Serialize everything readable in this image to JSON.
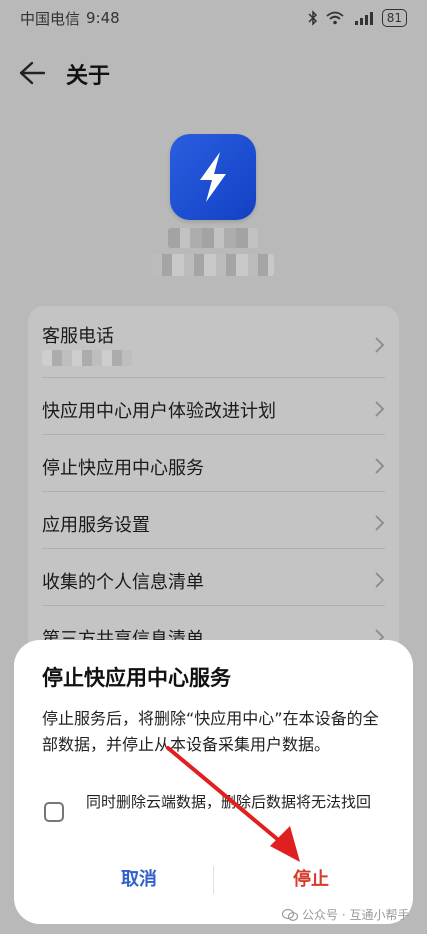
{
  "status_bar": {
    "carrier": "中国电信",
    "time": "9:48",
    "battery": "81"
  },
  "header": {
    "title": "关于"
  },
  "menu": {
    "items": [
      {
        "label": "客服电话"
      },
      {
        "label": "快应用中心用户体验改进计划"
      },
      {
        "label": "停止快应用中心服务"
      },
      {
        "label": "应用服务设置"
      },
      {
        "label": "收集的个人信息清单"
      },
      {
        "label": "第三方共享信息清单"
      }
    ]
  },
  "dialog": {
    "title": "停止快应用中心服务",
    "message": "停止服务后，将删除“快应用中心”在本设备的全部数据，并停止从本设备采集用户数据。",
    "checkbox_label": "同时删除云端数据，删除后数据将无法找回",
    "cancel_label": "取消",
    "stop_label": "停止"
  },
  "watermark": {
    "text": "公众号 · 互通小帮手"
  },
  "colors": {
    "accent_blue": "#2f62c8",
    "danger_red": "#d43b2a",
    "annotation_arrow": "#e02020"
  }
}
